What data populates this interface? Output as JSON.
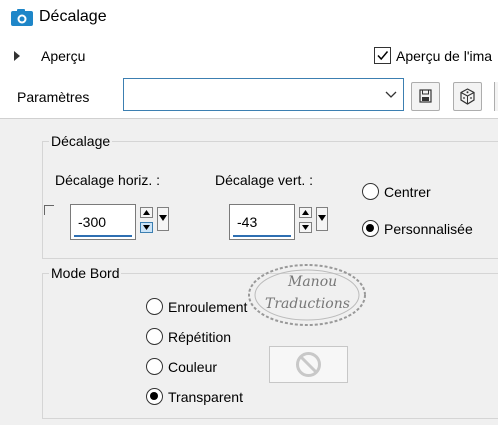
{
  "window": {
    "title": "Décalage",
    "icon": "camera-icon",
    "accent_color": "#1e86c8"
  },
  "preview": {
    "expand_label": "Aperçu",
    "checkbox_label": "Aperçu de l'ima",
    "checkbox_checked": true
  },
  "params": {
    "label": "Paramètres",
    "selected_value": "",
    "save_icon": "save-icon",
    "random_icon": "dice-icon"
  },
  "offset": {
    "group_label": "Décalage",
    "horiz_label": "Décalage horiz. :",
    "horiz_value": "-300",
    "vert_label": "Décalage vert. :",
    "vert_value": "-43",
    "radio_center": "Centrer",
    "radio_custom": "Personnalisée",
    "selected": "Personnalisée"
  },
  "border_mode": {
    "group_label": "Mode Bord",
    "options": [
      "Enroulement",
      "Répétition",
      "Couleur",
      "Transparent"
    ],
    "selected": "Transparent"
  },
  "watermark": {
    "line1": "Manou",
    "line2": "Traductions"
  }
}
